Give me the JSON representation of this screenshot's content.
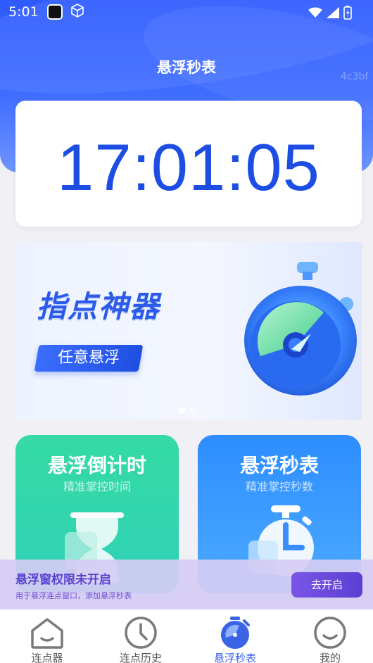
{
  "status_bar": {
    "time": "5:01"
  },
  "header": {
    "title": "悬浮秒表",
    "watermark": "4c3bf"
  },
  "clock": {
    "time": "17:01:05"
  },
  "banner": {
    "title": "指点神器",
    "tag": "任意悬浮",
    "dots": 2,
    "active_dot": 0
  },
  "cards": [
    {
      "title": "悬浮倒计时",
      "subtitle": "精准掌控时间",
      "icon": "hourglass-icon"
    },
    {
      "title": "悬浮秒表",
      "subtitle": "精准掌控秒数",
      "icon": "stopwatch-icon"
    }
  ],
  "permission_bar": {
    "title": "悬浮窗权限未开启",
    "description": "用于悬浮连点窗口，添加悬浮秒表",
    "button": "去开启"
  },
  "bottom_nav": {
    "items": [
      {
        "label": "连点器",
        "icon": "home-icon",
        "active": false
      },
      {
        "label": "连点历史",
        "icon": "clock-icon",
        "active": false
      },
      {
        "label": "悬浮秒表",
        "icon": "stopwatch-icon",
        "active": true
      },
      {
        "label": "我的",
        "icon": "smiley-icon",
        "active": false
      }
    ]
  },
  "colors": {
    "primary": "#2f5bff",
    "clock_text": "#1d4ee4",
    "countdown_card": "#35dba3",
    "stopwatch_card": "#2d8dff",
    "permission_accent": "#5b3fd3",
    "nav_active": "#3b63e6"
  }
}
